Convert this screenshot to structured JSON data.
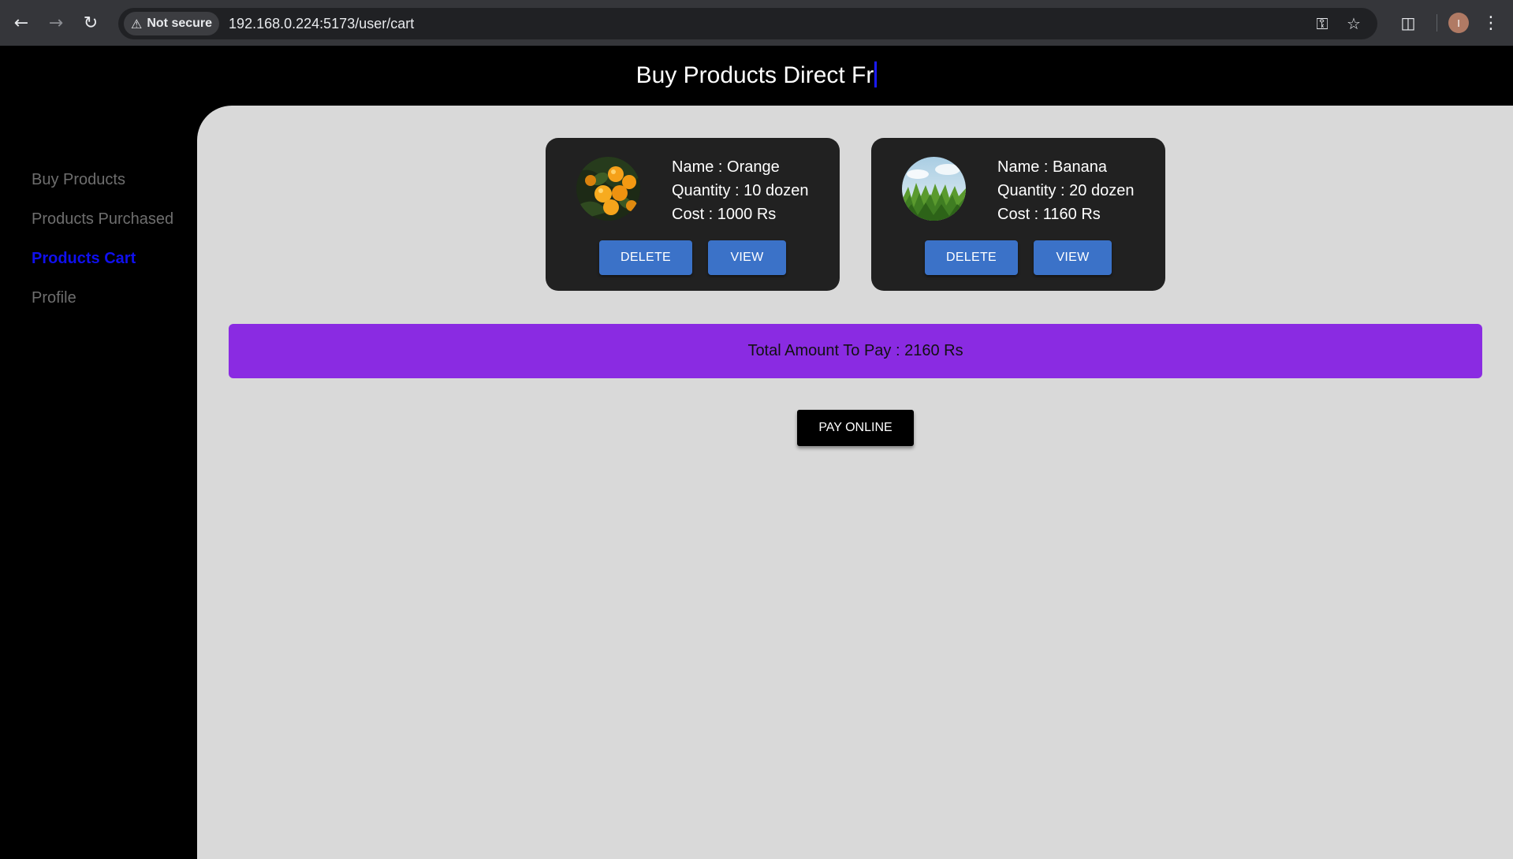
{
  "browser": {
    "back_icon": "arrow-left-icon",
    "forward_icon": "arrow-right-icon",
    "reload_icon": "reload-icon",
    "security_label": "Not secure",
    "url": "192.168.0.224:5173/user/cart",
    "avatar_letter": "I"
  },
  "header": {
    "title": "Buy Products Direct Fr"
  },
  "sidebar": {
    "items": [
      {
        "label": "Buy Products",
        "active": false
      },
      {
        "label": "Products Purchased",
        "active": false
      },
      {
        "label": "Products Cart",
        "active": true
      },
      {
        "label": "Profile",
        "active": false
      }
    ]
  },
  "cart": {
    "items": [
      {
        "name": "Name : Orange",
        "quantity": "Quantity : 10 dozen",
        "cost": "Cost : 1000 Rs",
        "delete_label": "DELETE",
        "view_label": "VIEW"
      },
      {
        "name": "Name : Banana",
        "quantity": "Quantity : 20 dozen",
        "cost": "Cost : 1160 Rs",
        "delete_label": "DELETE",
        "view_label": "VIEW"
      }
    ],
    "total": "Total Amount To Pay : 2160 Rs",
    "pay_label": "PAY ONLINE"
  },
  "colors": {
    "accent_active": "#1010ee",
    "button_blue": "#3b72c8",
    "total_bar": "#8a2be2",
    "card_bg": "#212121",
    "main_bg": "#d9d9d9"
  }
}
